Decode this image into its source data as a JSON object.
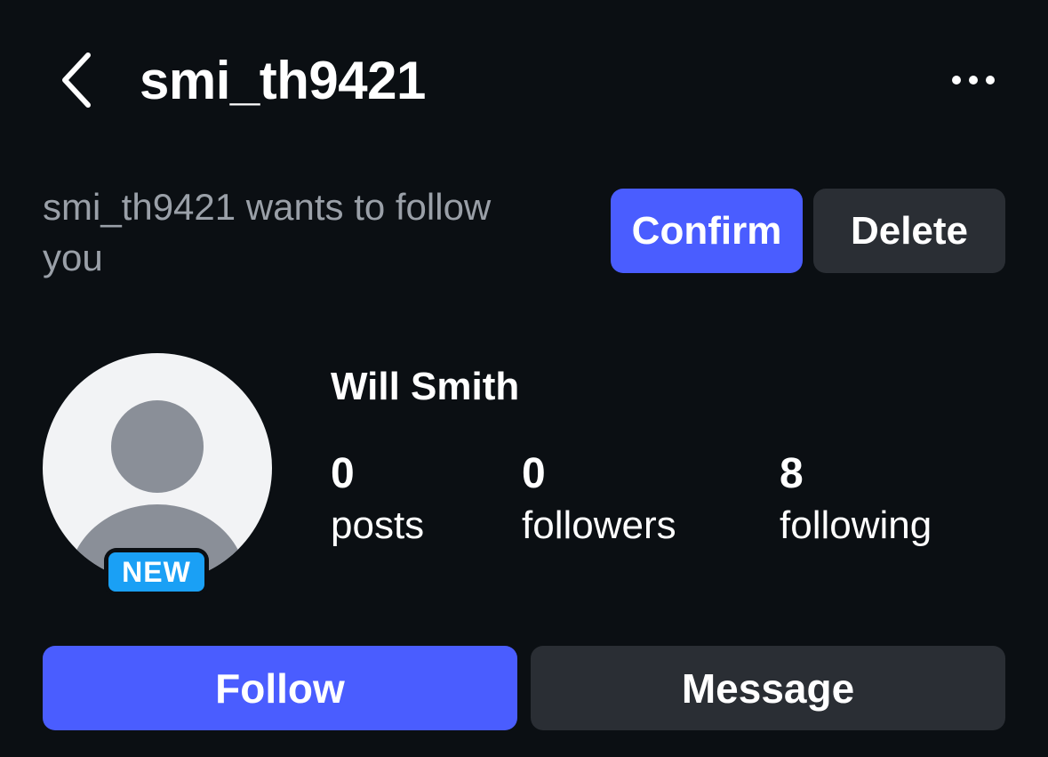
{
  "header": {
    "username": "smi_th9421",
    "back_icon": "chevron-left-icon",
    "more_icon": "more-horizontal-icon"
  },
  "request": {
    "text": "smi_th9421 wants to follow you",
    "confirm_label": "Confirm",
    "delete_label": "Delete"
  },
  "profile": {
    "avatar_icon": "default-avatar-icon",
    "badge": "NEW",
    "display_name": "Will Smith",
    "stats": [
      {
        "count": "0",
        "label": "posts"
      },
      {
        "count": "0",
        "label": "followers"
      },
      {
        "count": "8",
        "label": "following"
      }
    ]
  },
  "actions": {
    "follow_label": "Follow",
    "message_label": "Message"
  },
  "colors": {
    "background": "#0b0f13",
    "accent": "#4a5dff",
    "secondary_button": "#2a2e34",
    "badge": "#1aa0f5",
    "muted_text": "#9aa0a8"
  }
}
